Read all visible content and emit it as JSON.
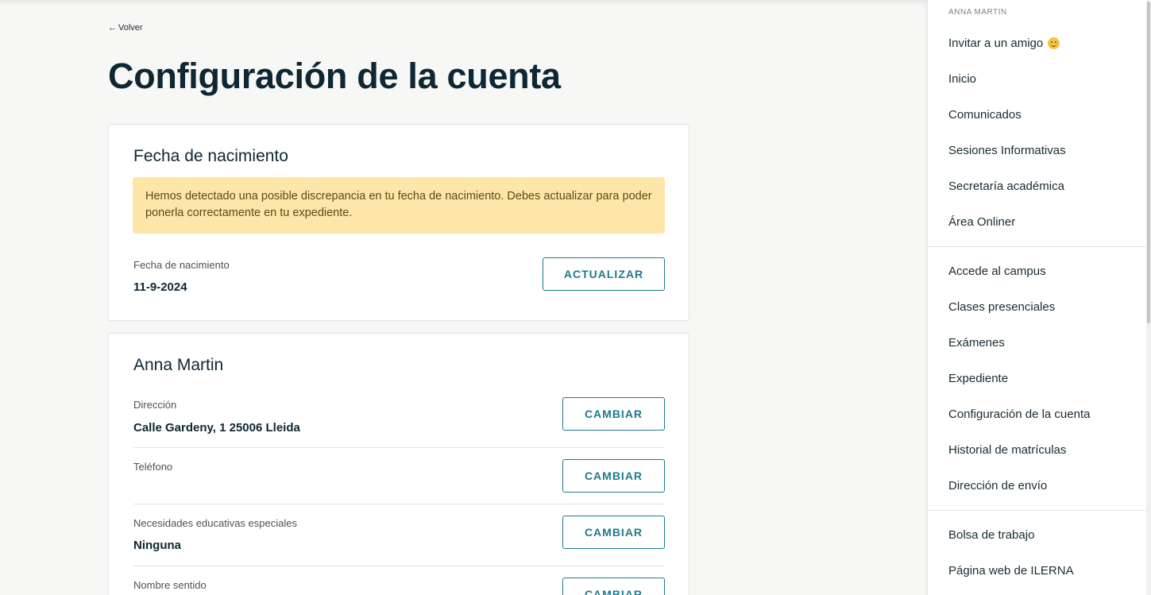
{
  "nav": {
    "back_label": "Volver"
  },
  "page": {
    "title": "Configuración de la cuenta"
  },
  "birthdate_card": {
    "title": "Fecha de nacimiento",
    "alert": "Hemos detectado una posible discrepancia en tu fecha de nacimiento. Debes actualizar para poder ponerla correctamente en tu expediente.",
    "field_label": "Fecha de nacimiento",
    "field_value": "11-9-2024",
    "button_label": "ACTUALIZAR"
  },
  "profile_card": {
    "title": "Anna Martin",
    "rows": [
      {
        "label": "Dirección",
        "value": "Calle Gardeny, 1 25006 Lleida",
        "button": "CAMBIAR"
      },
      {
        "label": "Teléfono",
        "value": "",
        "button": "CAMBIAR"
      },
      {
        "label": "Necesidades educativas especiales",
        "value": "Ninguna",
        "button": "CAMBIAR"
      },
      {
        "label": "Nombre sentido",
        "value": "",
        "button": "CAMBIAR"
      }
    ]
  },
  "sidebar": {
    "user": "ANNA MARTIN",
    "group1": [
      "Invitar a un amigo",
      "Inicio",
      "Comunicados",
      "Sesiones Informativas",
      "Secretaría académica",
      "Área Onliner"
    ],
    "group2": [
      "Accede al campus",
      "Clases presenciales",
      "Exámenes",
      "Expediente",
      "Configuración de la cuenta",
      "Historial de matrículas",
      "Dirección de envío"
    ],
    "group3": [
      "Bolsa de trabajo",
      "Página web de ILERNA"
    ]
  },
  "colors": {
    "accent": "#1e7a8c",
    "alert_bg": "#fde6a8",
    "title": "#0f2633"
  },
  "icons": {
    "invite": "smiley-emoji-icon",
    "back": "arrow-left-icon"
  }
}
